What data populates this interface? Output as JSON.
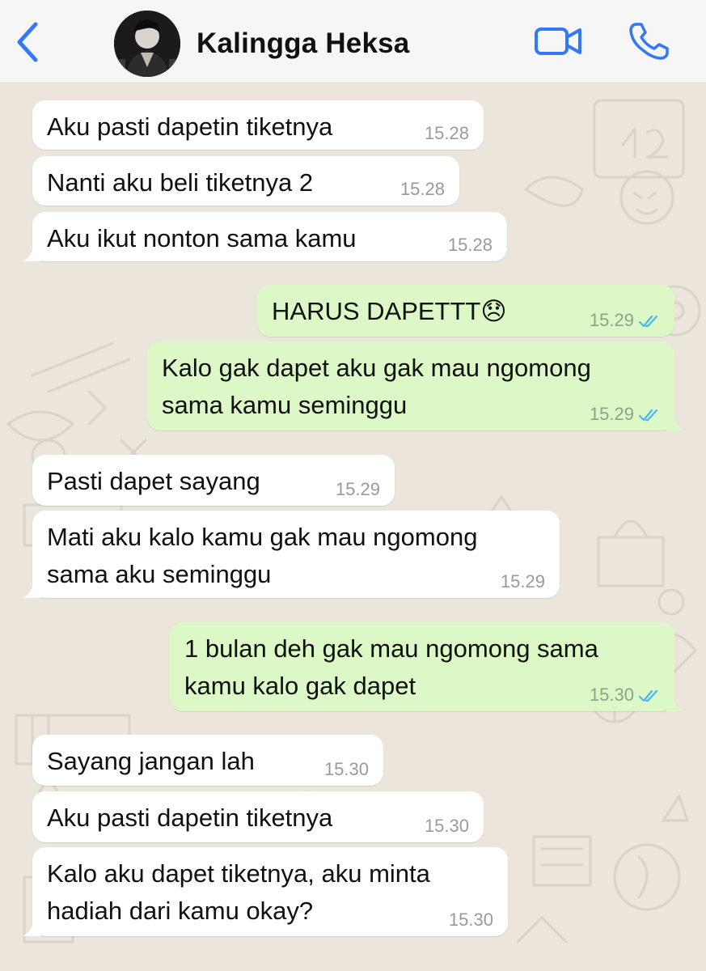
{
  "header": {
    "back_label": "",
    "contact_name": "Kalingga Heksa"
  },
  "icons": {
    "back": "chevron-left-icon",
    "video": "video-camera-icon",
    "call": "phone-icon",
    "read_receipt": "double-check-icon"
  },
  "colors": {
    "accent": "#3478f6",
    "incoming_bubble": "#ffffff",
    "outgoing_bubble": "#dcf8c6",
    "read_tick": "#4fb6ec"
  },
  "messages": [
    {
      "dir": "in",
      "text": "Aku pasti dapetin tiketnya",
      "time": "15.28"
    },
    {
      "dir": "in",
      "text": "Nanti aku beli tiketnya 2",
      "time": "15.28"
    },
    {
      "dir": "in",
      "text": "Aku ikut nonton sama kamu",
      "time": "15.28"
    },
    {
      "dir": "out",
      "text": "HARUS DAPETTT😞",
      "time": "15.29"
    },
    {
      "dir": "out",
      "text": "Kalo gak dapet aku gak mau ngomong\nsama kamu seminggu",
      "time": "15.29"
    },
    {
      "dir": "in",
      "text": "Pasti dapet sayang",
      "time": "15.29"
    },
    {
      "dir": "in",
      "text": "Mati aku kalo kamu gak mau ngomong\nsama aku seminggu",
      "time": "15.29"
    },
    {
      "dir": "out",
      "text": "1 bulan deh gak mau ngomong sama\nkamu kalo gak dapet",
      "time": "15.30"
    },
    {
      "dir": "in",
      "text": "Sayang jangan lah",
      "time": "15.30"
    },
    {
      "dir": "in",
      "text": "Aku pasti dapetin tiketnya",
      "time": "15.30"
    },
    {
      "dir": "in",
      "text": "Kalo aku dapet tiketnya, aku minta\nhadiah dari kamu okay?",
      "time": "15.30"
    }
  ]
}
